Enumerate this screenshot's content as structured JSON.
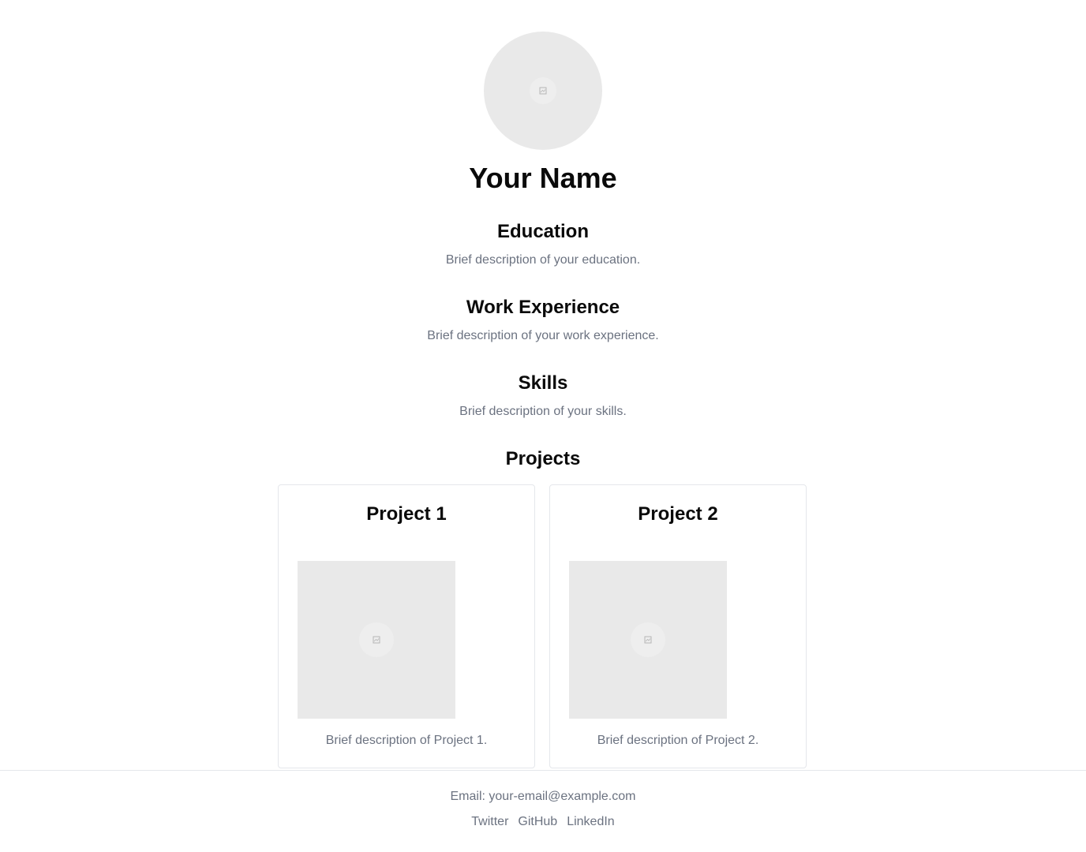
{
  "profile": {
    "name": "Your Name"
  },
  "sections": [
    {
      "title": "Education",
      "description": "Brief description of your education."
    },
    {
      "title": "Work Experience",
      "description": "Brief description of your work experience."
    },
    {
      "title": "Skills",
      "description": "Brief description of your skills."
    }
  ],
  "projects": {
    "title": "Projects",
    "items": [
      {
        "title": "Project 1",
        "description": "Brief description of Project 1."
      },
      {
        "title": "Project 2",
        "description": "Brief description of Project 2."
      }
    ]
  },
  "footer": {
    "email": "Email: your-email@example.com",
    "links": [
      "Twitter",
      "GitHub",
      "LinkedIn"
    ]
  },
  "colors": {
    "text": "#0a0a0a",
    "muted": "#6b7280",
    "placeholder": "#e9e9e9",
    "border": "#e5e7eb"
  }
}
